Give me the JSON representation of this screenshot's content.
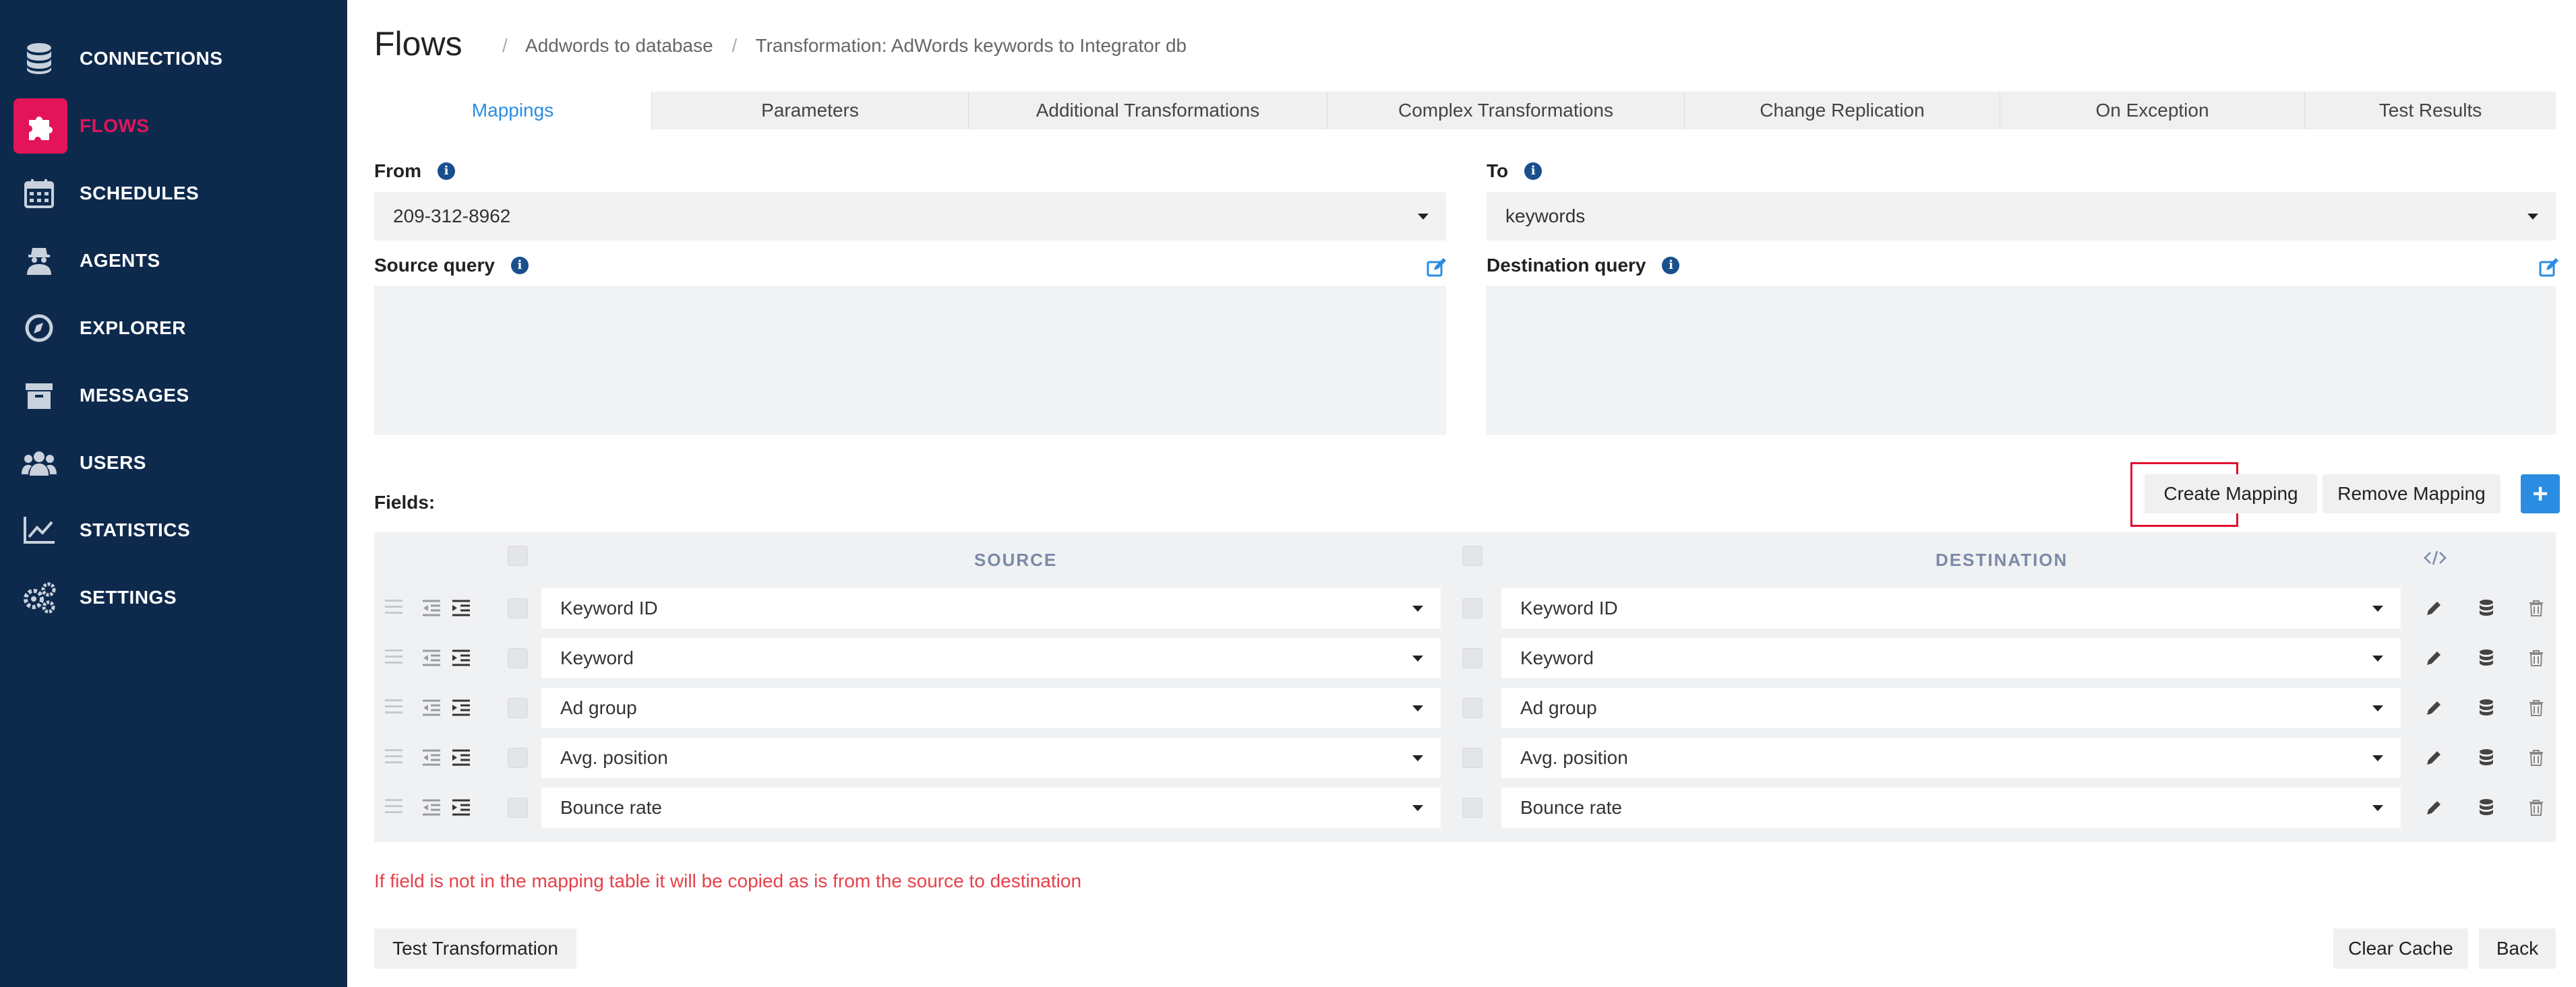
{
  "sidebar": {
    "items": [
      {
        "label": "CONNECTIONS",
        "icon": "database-icon"
      },
      {
        "label": "FLOWS",
        "icon": "puzzle-icon",
        "active": true
      },
      {
        "label": "SCHEDULES",
        "icon": "calendar-icon"
      },
      {
        "label": "AGENTS",
        "icon": "agent-icon"
      },
      {
        "label": "EXPLORER",
        "icon": "compass-icon"
      },
      {
        "label": "MESSAGES",
        "icon": "archive-icon"
      },
      {
        "label": "USERS",
        "icon": "users-icon"
      },
      {
        "label": "STATISTICS",
        "icon": "chart-line-icon"
      },
      {
        "label": "SETTINGS",
        "icon": "gears-icon"
      }
    ]
  },
  "header": {
    "title": "Flows",
    "breadcrumbs": [
      "Addwords to database",
      "Transformation: AdWords keywords to Integrator db"
    ]
  },
  "tabs": [
    "Mappings",
    "Parameters",
    "Additional Transformations",
    "Complex Transformations",
    "Change Replication",
    "On Exception",
    "Test Results"
  ],
  "form": {
    "from_label": "From",
    "from_value": "209-312-8962",
    "to_label": "To",
    "to_value": "keywords",
    "source_query_label": "Source query",
    "destination_query_label": "Destination query"
  },
  "fields": {
    "label": "Fields:",
    "create_mapping": "Create Mapping",
    "remove_mapping": "Remove Mapping",
    "add": "+",
    "source_header": "SOURCE",
    "destination_header": "DESTINATION",
    "rows": [
      {
        "source": "Keyword ID",
        "destination": "Keyword ID"
      },
      {
        "source": "Keyword",
        "destination": "Keyword"
      },
      {
        "source": "Ad group",
        "destination": "Ad group"
      },
      {
        "source": "Avg. position",
        "destination": "Avg. position"
      },
      {
        "source": "Bounce rate",
        "destination": "Bounce rate"
      }
    ]
  },
  "note": "If field is not in the mapping table it will be copied as is from the source to destination",
  "footer": {
    "test_transformation": "Test Transformation",
    "clear_cache": "Clear Cache",
    "back": "Back"
  },
  "colors": {
    "sidebar_bg": "#0d2a4d",
    "accent": "#e3145a",
    "primary": "#2a8de2",
    "warning_text": "#e8404a",
    "highlight": "#e0102c"
  }
}
